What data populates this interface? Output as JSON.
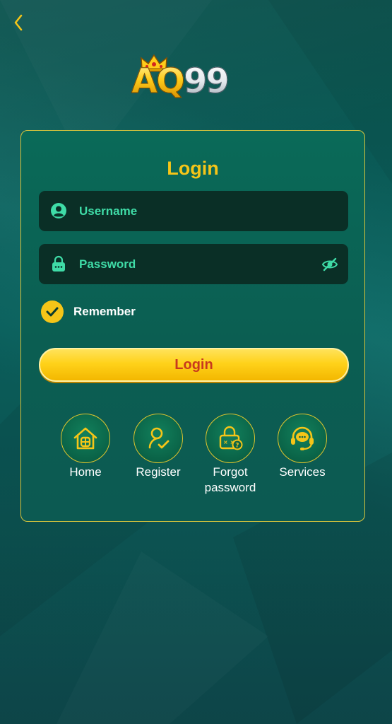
{
  "header": {
    "back_icon": "chevron-left-icon"
  },
  "brand": {
    "logo_text_a": "AQ",
    "logo_text_b": "99",
    "crown_icon": "crown-icon"
  },
  "login_card": {
    "title": "Login",
    "username": {
      "placeholder": "Username",
      "icon": "user-icon"
    },
    "password": {
      "placeholder": "Password",
      "icon": "lock-icon",
      "toggle_icon": "eye-off-icon"
    },
    "remember": {
      "label": "Remember",
      "checked": true
    },
    "submit_label": "Login",
    "shortcuts": [
      {
        "label": "Home",
        "icon": "home-icon"
      },
      {
        "label": "Register",
        "icon": "register-icon"
      },
      {
        "label": "Forgot password",
        "icon": "forgot-password-icon"
      },
      {
        "label": "Services",
        "icon": "customer-service-icon"
      }
    ]
  },
  "colors": {
    "accent_gold": "#f5c518",
    "placeholder_green": "#3fdca7",
    "button_text_red": "#c8391e",
    "background_teal": "#0b6a66",
    "field_bg": "#0a2f26"
  }
}
